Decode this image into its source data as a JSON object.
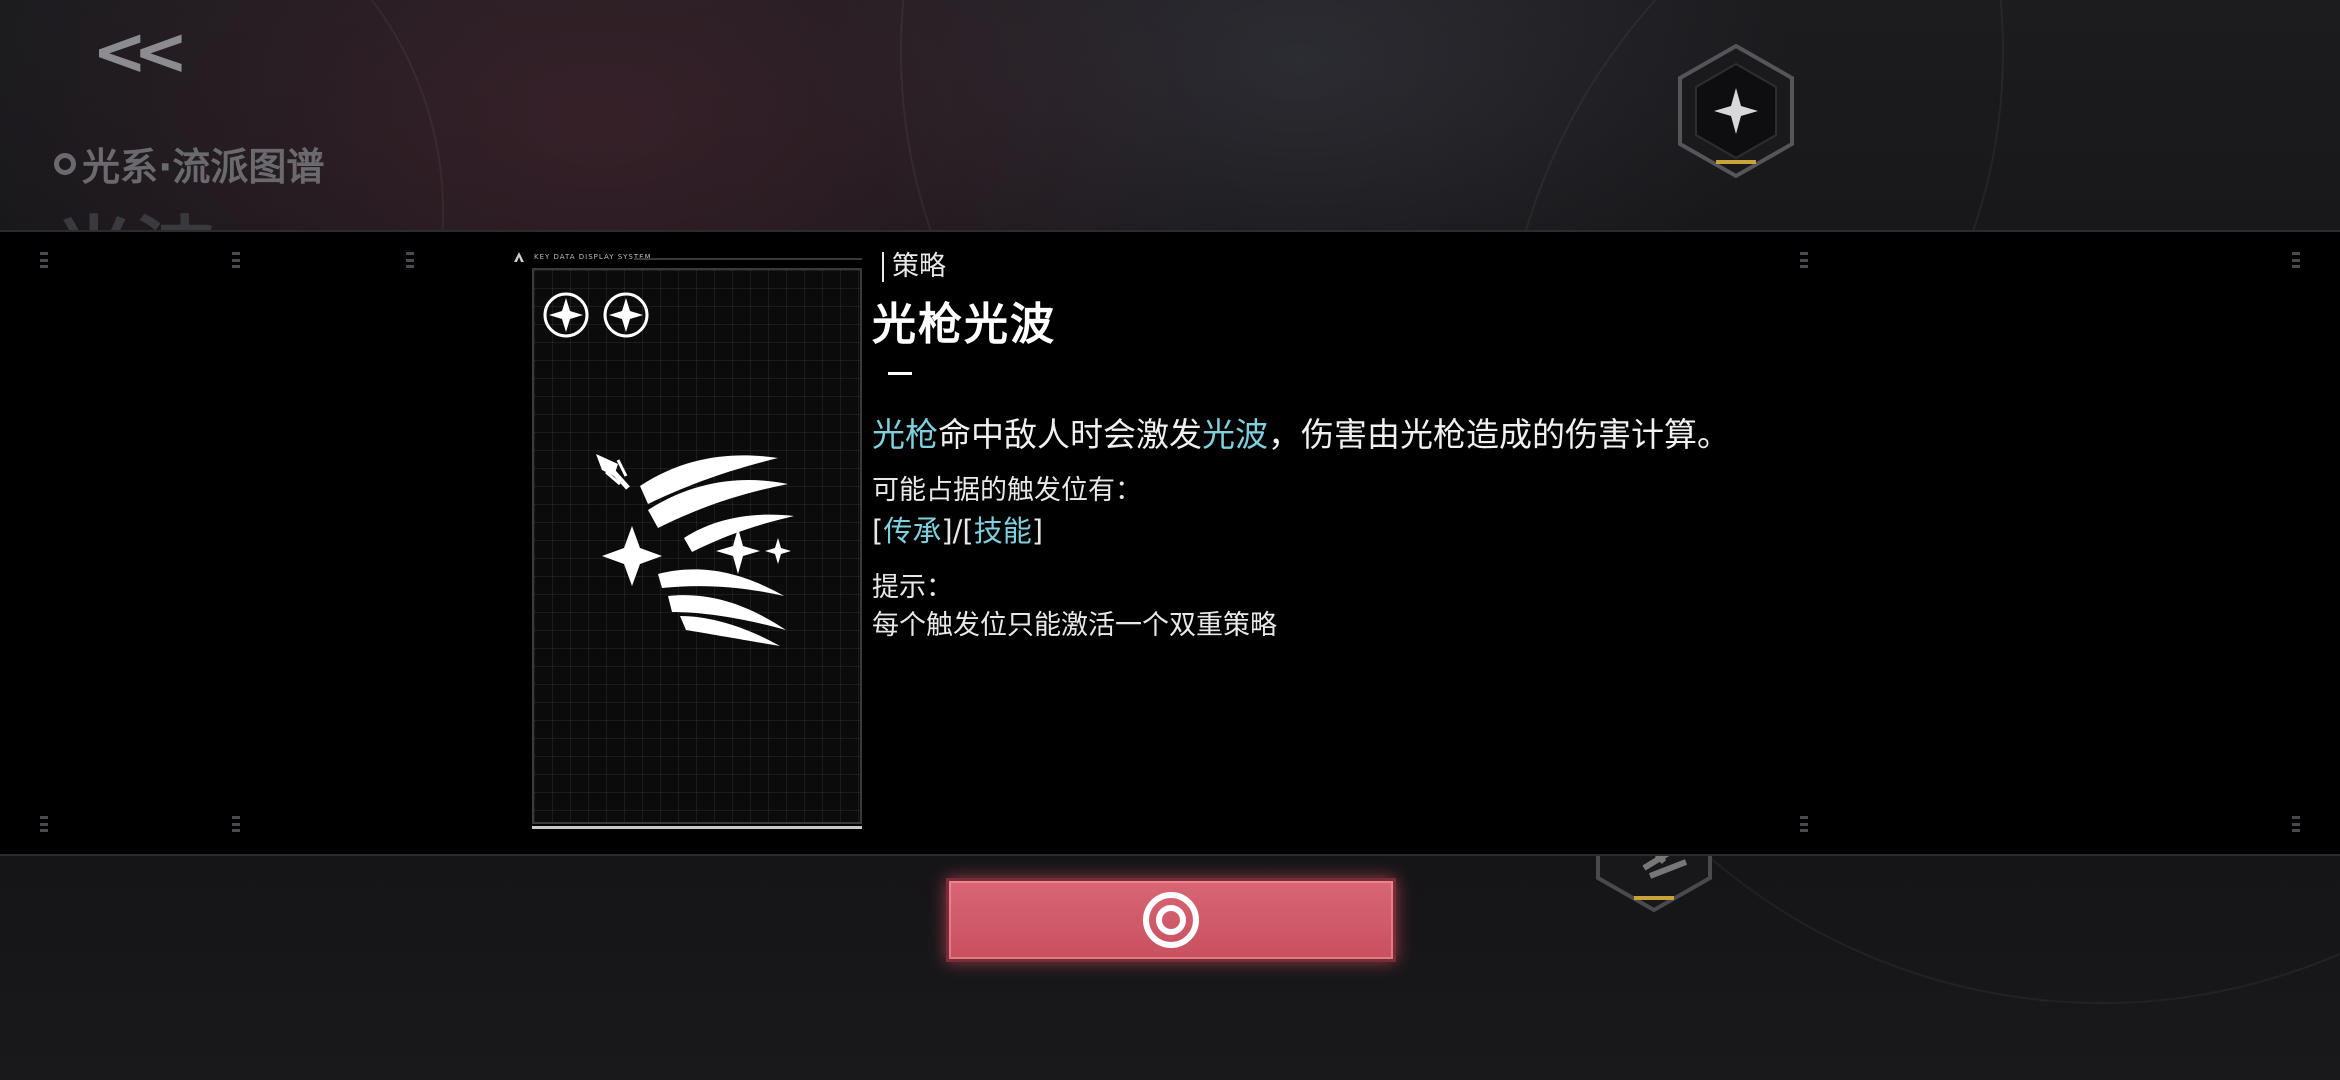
{
  "nav": {
    "back_label": "<<"
  },
  "background": {
    "subtitle": "光系·流派图谱",
    "title": "光波"
  },
  "card": {
    "header_text": "KEY DATA DISPLAY SYSTEM",
    "rank_stars": 2,
    "icon": "light-spear-wave-icon"
  },
  "detail": {
    "category": "策略",
    "name": "光枪光波",
    "description": {
      "part1": "光枪",
      "part2": "命中敌人时会激发",
      "part3": "光波",
      "part4": "，伤害由光枪造成的伤害计算。"
    },
    "slots_label": "可能占据的触发位有：",
    "slots": {
      "open1": "[",
      "slot1": "传承",
      "mid": "]/[",
      "slot2": "技能",
      "close2": "]"
    },
    "tip_label": "提示：",
    "tip_text": "每个触发位只能激活一个双重策略"
  },
  "confirm": {
    "icon": "ring-target-icon"
  },
  "colors": {
    "highlight": "#7fd0de",
    "confirm_button": "#d05a68",
    "band": "#000000"
  }
}
